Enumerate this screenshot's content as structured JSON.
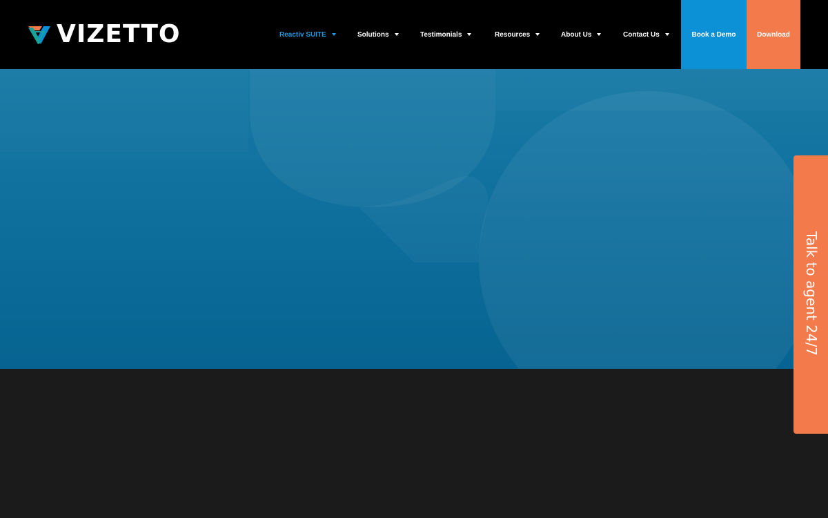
{
  "brand": {
    "name": "VIZETTO",
    "logo_icon": "vizetto-triangle-icon",
    "colors": {
      "orange": "#f37a4a",
      "teal": "#1aa39a",
      "blue": "#0c90d6",
      "hero_blue": "#0d6d9b",
      "header_bg": "#000000",
      "dark_bg": "#1b1b1b"
    }
  },
  "nav": {
    "items": [
      {
        "label": "Reactiv SUITE",
        "active": true,
        "icon": "chevron-down-icon"
      },
      {
        "label": "Solutions",
        "active": false,
        "icon": "chevron-down-icon"
      },
      {
        "label": "Testimonials",
        "active": false,
        "icon": "chevron-down-icon"
      },
      {
        "label": "Resources",
        "active": false,
        "icon": "chevron-down-icon"
      },
      {
        "label": "About Us",
        "active": false,
        "icon": "chevron-down-icon"
      },
      {
        "label": "Contact Us",
        "active": false,
        "icon": "chevron-down-icon"
      }
    ]
  },
  "cta": {
    "book_demo": "Book a Demo",
    "download": "Download"
  },
  "side_tab": {
    "label": "Talk to agent 24/7"
  }
}
